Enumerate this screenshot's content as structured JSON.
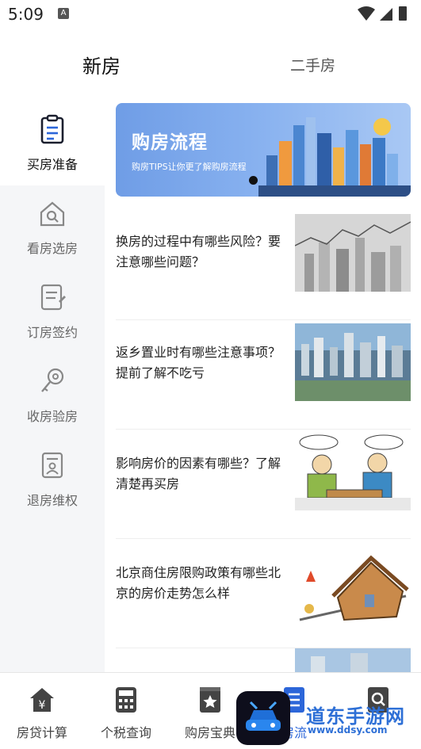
{
  "status_bar": {
    "time": "5:09",
    "indicator": "A"
  },
  "top_tabs": {
    "new_house": "新房",
    "second_hand": "二手房"
  },
  "sidebar": {
    "items": [
      {
        "label": "买房准备",
        "icon": "clipboard-icon",
        "active": true
      },
      {
        "label": "看房选房",
        "icon": "house-search-icon",
        "active": false
      },
      {
        "label": "订房签约",
        "icon": "document-sign-icon",
        "active": false
      },
      {
        "label": "收房验房",
        "icon": "key-icon",
        "active": false
      },
      {
        "label": "退房维权",
        "icon": "id-card-icon",
        "active": false
      }
    ]
  },
  "banner": {
    "title": "购房流程",
    "subtitle": "购房TIPS让你更了解购房流程"
  },
  "articles": [
    {
      "title": "换房的过程中有哪些风险？要注意哪些问题？",
      "thumb": "stock-chart-city"
    },
    {
      "title": "返乡置业时有哪些注意事项？提前了解不吃亏",
      "thumb": "city-aerial"
    },
    {
      "title": "影响房价的因素有哪些？了解清楚再买房",
      "thumb": "cartoon-negotiation"
    },
    {
      "title": "北京商住房限购政策有哪些北京的房价走势怎么样",
      "thumb": "house-seesaw"
    }
  ],
  "bottom_nav": {
    "items": [
      {
        "label": "房贷计算",
        "icon": "house-yen-icon"
      },
      {
        "label": "个税查询",
        "icon": "calculator-icon"
      },
      {
        "label": "购房宝典",
        "icon": "star-book-icon"
      },
      {
        "label": "房流",
        "icon": "list-icon"
      },
      {
        "label": "",
        "icon": "search-icon"
      }
    ]
  },
  "watermark": {
    "text": "道东手游网",
    "sub": "www.ddsy.com"
  },
  "colors": {
    "banner_blue": "#7ea8ec",
    "sidebar_bg": "#f5f6f8",
    "watermark_blue": "#2d6fd6"
  }
}
